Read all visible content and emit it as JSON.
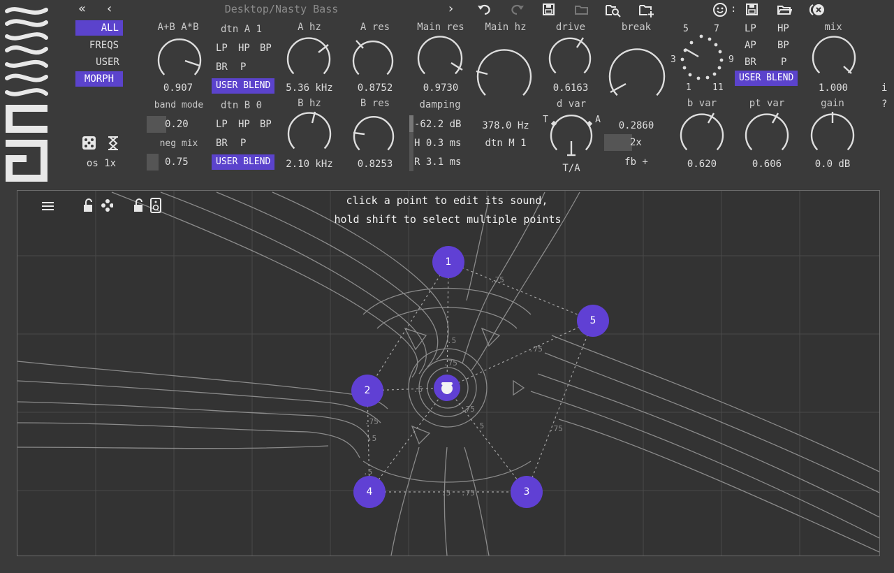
{
  "header": {
    "preset_path": "Desktop/Nasty Bass",
    "nav_back_label": "«",
    "nav_prev_label": "‹",
    "nav_next_label": "›",
    "user_colon": ":"
  },
  "left_panel": {
    "buttons": [
      "ALL",
      "FREQS",
      "USER",
      "MORPH"
    ],
    "band_mode_label": "band mode",
    "band_mode_value": "0.20",
    "neg_mix_label": "neg mix",
    "neg_mix_value": "0.75",
    "oversample_label": "os 1x"
  },
  "knobs": {
    "ab": {
      "label": "A+B A*B",
      "value": "0.907"
    },
    "a_hz": {
      "label": "A hz",
      "value": "5.36 kHz"
    },
    "a_res": {
      "label": "A res",
      "value": "0.8752"
    },
    "main_res": {
      "label": "Main res",
      "value": "0.9730"
    },
    "main_hz": {
      "label": "Main hz",
      "value": "378.0 Hz"
    },
    "drive": {
      "label": "drive",
      "value": "0.6163"
    },
    "break": {
      "label": "break",
      "value": "0.2860"
    },
    "mix": {
      "label": "mix",
      "value": "1.000"
    },
    "b_hz": {
      "label": "B hz",
      "value": "2.10 kHz"
    },
    "b_res": {
      "label": "B res",
      "value": "0.8253"
    },
    "d_var": {
      "label": "d var",
      "value": "T/A"
    },
    "b_var": {
      "label": "b var",
      "value": "0.620"
    },
    "pt_var": {
      "label": "pt var",
      "value": "0.606"
    },
    "gain": {
      "label": "gain",
      "value": "0.0 dB"
    }
  },
  "filter_a": {
    "dtn_label": "dtn A 1",
    "types": [
      "LP",
      "HP",
      "BP",
      "BR",
      "P"
    ],
    "blend_label": "USER BLEND"
  },
  "filter_b": {
    "dtn_label": "dtn B 0",
    "types": [
      "LP",
      "HP",
      "BP",
      "BR",
      "P"
    ],
    "blend_label": "USER BLEND"
  },
  "damping": {
    "label": "damping",
    "db": "-62.2 dB",
    "hold": "H 0.3 ms",
    "release": "R 3.1 ms"
  },
  "dtn_m": "dtn M 1",
  "d_var_markers": {
    "t": "T",
    "a": "A"
  },
  "break_extra": {
    "mult": "2x",
    "fb": "fb +"
  },
  "rotary_selector": {
    "labels": [
      "5",
      "7",
      "3",
      "9",
      "1",
      "11"
    ]
  },
  "right_filter": {
    "types": [
      "LP",
      "HP",
      "AP",
      "BP",
      "BR",
      "P"
    ],
    "blend_label": "USER BLEND"
  },
  "side_icons": {
    "info": "i",
    "help": "?"
  },
  "canvas": {
    "hint_line1": "click a point to edit its sound,",
    "hint_line2": "hold shift to select multiple points",
    "points": [
      "1",
      "2",
      "3",
      "4",
      "5"
    ],
    "contour_labels": [
      ".75",
      ".5",
      ".75",
      ".5",
      ".75",
      ".5",
      ".75",
      ".5",
      ".5",
      ".75",
      ".5",
      ".75",
      ".75"
    ]
  },
  "colors": {
    "accent": "#5b43cc",
    "point": "#6040d4",
    "background": "#3a3a3a",
    "canvas": "#333333"
  },
  "icons": [
    "undo-icon",
    "redo-icon",
    "save-icon",
    "folder-icon",
    "search-icon",
    "add-preset-icon",
    "user-icon",
    "bypass-icon",
    "dice-icon",
    "hourglass-icon",
    "menu-icon",
    "lock-move-icon",
    "lock-speaker-icon"
  ]
}
